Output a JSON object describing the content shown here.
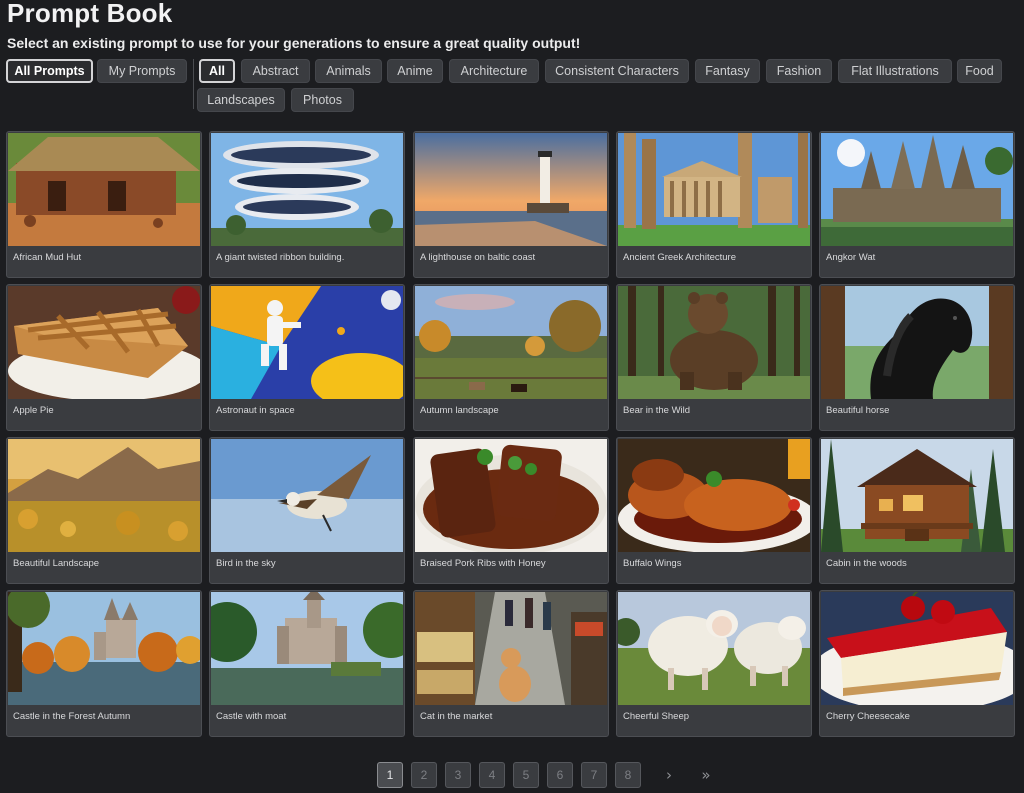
{
  "page": {
    "title": "Prompt Book",
    "subtitle": "Select an existing prompt to use for your generations to ensure a great quality output!"
  },
  "scope_tabs": [
    {
      "label": "All Prompts",
      "active": true
    },
    {
      "label": "My Prompts",
      "active": false
    }
  ],
  "categories": [
    {
      "label": "All",
      "active": true
    },
    {
      "label": "Abstract",
      "active": false
    },
    {
      "label": "Animals",
      "active": false
    },
    {
      "label": "Anime",
      "active": false
    },
    {
      "label": "Architecture",
      "active": false
    },
    {
      "label": "Consistent Characters",
      "active": false
    },
    {
      "label": "Fantasy",
      "active": false
    },
    {
      "label": "Fashion",
      "active": false
    },
    {
      "label": "Flat Illustrations",
      "active": false
    },
    {
      "label": "Food",
      "active": false
    },
    {
      "label": "Landscapes",
      "active": false
    },
    {
      "label": "Photos",
      "active": false
    }
  ],
  "prompts": [
    {
      "label": "African Mud Hut",
      "thumb": "mud-hut"
    },
    {
      "label": "A giant twisted ribbon building.",
      "thumb": "ribbon-building"
    },
    {
      "label": "A lighthouse on baltic coast",
      "thumb": "lighthouse"
    },
    {
      "label": "Ancient Greek Architecture",
      "thumb": "greek-temple"
    },
    {
      "label": "Angkor Wat",
      "thumb": "angkor-wat"
    },
    {
      "label": "Apple Pie",
      "thumb": "apple-pie"
    },
    {
      "label": "Astronaut in space",
      "thumb": "astronaut"
    },
    {
      "label": "Autumn landscape",
      "thumb": "autumn-landscape"
    },
    {
      "label": "Bear in the Wild",
      "thumb": "bear"
    },
    {
      "label": "Beautiful horse",
      "thumb": "horse"
    },
    {
      "label": "Beautiful Landscape",
      "thumb": "mountain-landscape"
    },
    {
      "label": "Bird in the sky",
      "thumb": "bird"
    },
    {
      "label": "Braised Pork Ribs with Honey",
      "thumb": "pork-ribs"
    },
    {
      "label": "Buffalo Wings",
      "thumb": "buffalo-wings"
    },
    {
      "label": "Cabin in the woods",
      "thumb": "cabin"
    },
    {
      "label": "Castle in the Forest Autumn",
      "thumb": "castle-autumn"
    },
    {
      "label": "Castle with moat",
      "thumb": "castle-moat"
    },
    {
      "label": "Cat in the market",
      "thumb": "cat-market"
    },
    {
      "label": "Cheerful Sheep",
      "thumb": "sheep"
    },
    {
      "label": "Cherry Cheesecake",
      "thumb": "cheesecake"
    }
  ],
  "pagination": {
    "pages": [
      "1",
      "2",
      "3",
      "4",
      "5",
      "6",
      "7",
      "8"
    ],
    "current": "1",
    "next_icon": "chevron-right-icon",
    "last_icon": "double-chevron-right-icon"
  },
  "colors": {
    "background": "#1c1d20",
    "card": "#3a3c40",
    "pill": "#3a3c40",
    "active_border": "#d4d4d6"
  }
}
